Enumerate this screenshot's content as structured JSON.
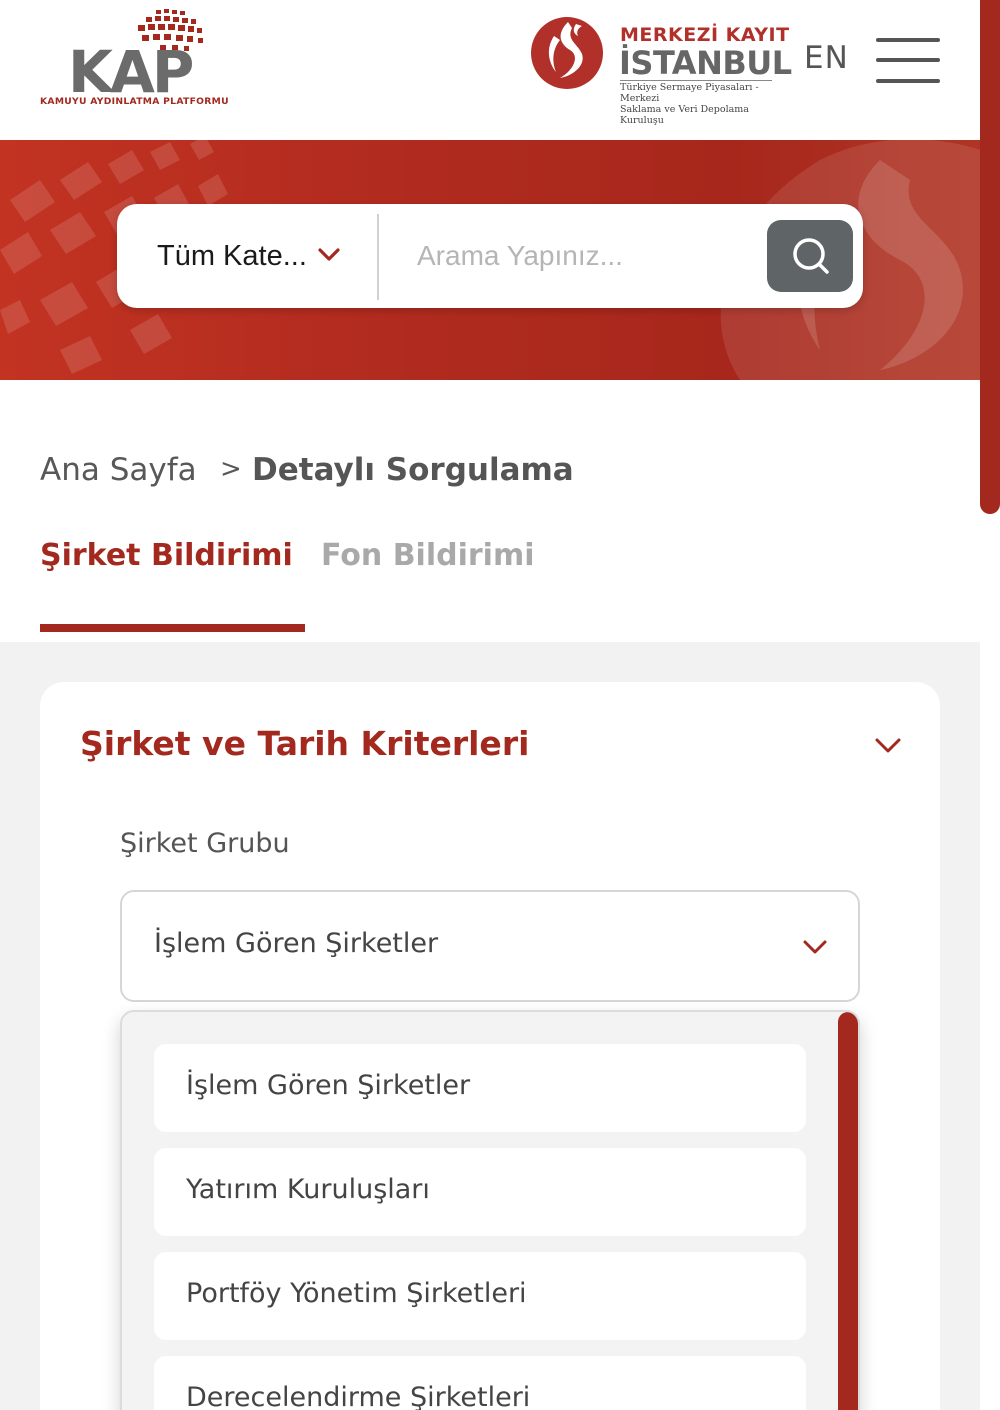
{
  "header": {
    "kap_logo": {
      "word": "KAP",
      "subtitle": "KAMUYU AYDINLATMA PLATFORMU"
    },
    "mkk_logo": {
      "name_line1": "MERKEZİ KAYIT",
      "name_line2": "İSTANBUL",
      "desc_line1": "Türkiye Sermaye Piyasaları - Merkezi",
      "desc_line2": "Saklama ve Veri Depolama Kuruluşu"
    },
    "language_label": "EN",
    "menu_icon": "hamburger-menu-icon"
  },
  "search": {
    "category_label": "Tüm Kate...",
    "placeholder": "Arama Yapınız...",
    "button_icon": "search-icon"
  },
  "breadcrumb": {
    "home": "Ana Sayfa",
    "separator": ">",
    "current": "Detaylı Sorgulama"
  },
  "tabs": [
    {
      "label": "Şirket Bildirimi",
      "active": true
    },
    {
      "label": "Fon Bildirimi",
      "active": false
    }
  ],
  "criteria_card": {
    "title": "Şirket ve Tarih Kriterleri",
    "company_group": {
      "label": "Şirket Grubu",
      "selected": "İşlem Gören Şirketler",
      "options": [
        "İşlem Gören Şirketler",
        "Yatırım Kuruluşları",
        "Portföy Yönetim Şirketleri",
        "Derecelendirme Şirketleri"
      ]
    }
  },
  "colors": {
    "brand_red": "#a3291f",
    "banner_red": "#b12b1f",
    "search_button": "#5f6466",
    "text_gray": "#555555",
    "muted_gray": "#a9a9a9",
    "page_bg_gray": "#f2f2f2"
  }
}
